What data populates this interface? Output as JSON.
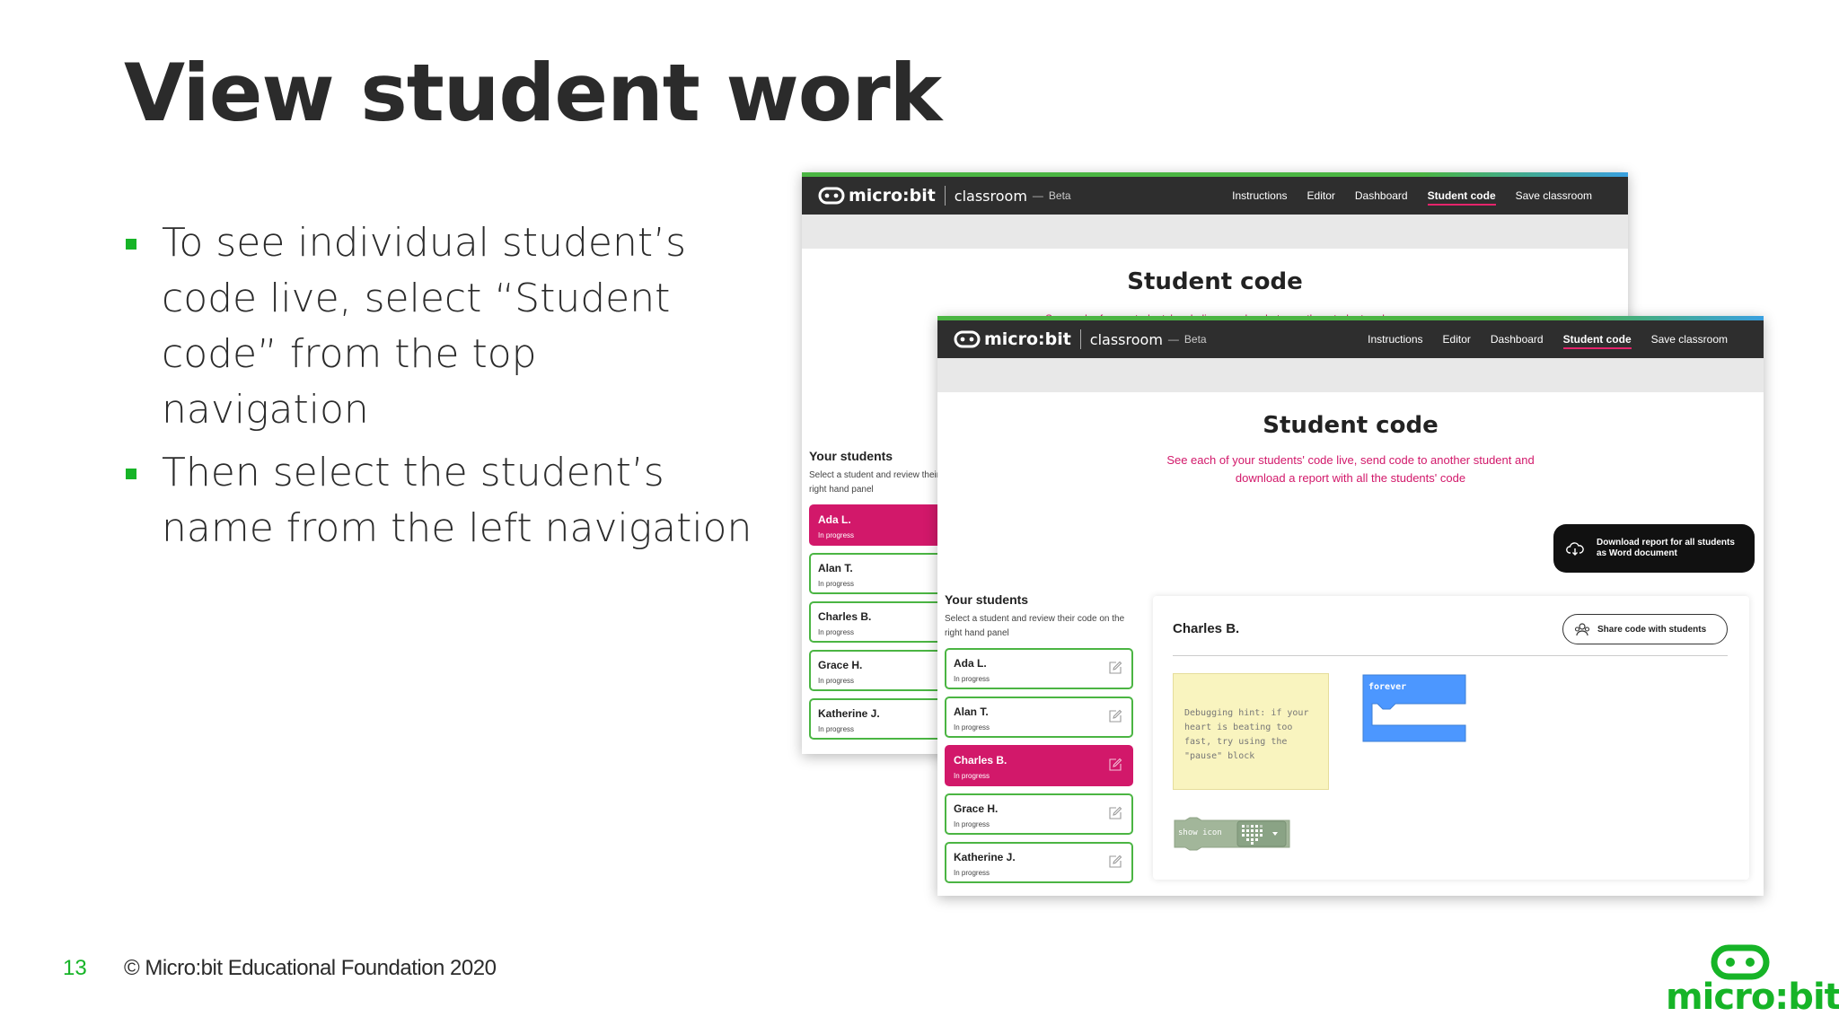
{
  "slide": {
    "title": "View student work",
    "bullets": [
      "To see individual student’s code live, select “Student code” from the top navigation",
      "Then select the student’s name from the left navigation"
    ],
    "page_number": "13",
    "copyright": "© Micro:bit Educational Foundation 2020",
    "logo_text": "micro:bit",
    "accent_color": "#16b427"
  },
  "app": {
    "logo": "micro:bit",
    "app_name": "classroom",
    "dash": "—",
    "beta": "Beta",
    "nav": [
      "Instructions",
      "Editor",
      "Dashboard",
      "Student code",
      "Save classroom"
    ],
    "active_nav": "Student code",
    "heading": "Student code",
    "subtitle_line1": "See each of your students' code live, send code to another student and",
    "subtitle_line2": "download a report with all the students' code",
    "back_subtitle_fragment": "See each of your students' code live, send code to another student and",
    "download_line1": "Download report for all students",
    "download_line2": "as Word document",
    "students_title": "Your students",
    "students_hint": "Select a student and review their code on the right hand panel",
    "back_students_hint": "Select a student and review their code on the right hand panel",
    "students": [
      {
        "name": "Ada L.",
        "status": "In progress"
      },
      {
        "name": "Alan T.",
        "status": "In progress"
      },
      {
        "name": "Charles B.",
        "status": "In progress"
      },
      {
        "name": "Grace H.",
        "status": "In progress"
      },
      {
        "name": "Katherine J.",
        "status": "In progress"
      }
    ],
    "back_selected": "Ada L.",
    "front_selected": "Charles B.",
    "panel_student": "Charles B.",
    "share_button": "Share code with students",
    "hint_text": "Debugging hint: if your heart is beating too fast, try using the \"pause\" block",
    "forever_label": "forever",
    "show_icon_label": "show icon",
    "colors": {
      "pink": "#d2186a",
      "green": "#4bb543",
      "block_blue": "#4c97ff",
      "topbar": "#2e2e2e"
    }
  }
}
